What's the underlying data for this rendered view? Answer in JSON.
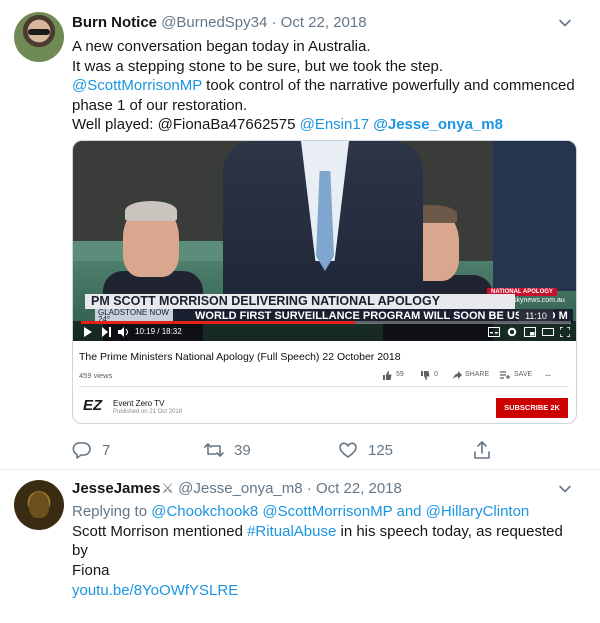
{
  "tweets": [
    {
      "display_name": "Burn Notice",
      "handle": "@BurnedSpy34",
      "date": "Oct 22, 2018",
      "lines": {
        "l1": "A new conversation began today in Australia.",
        "l2": "It was a stepping stone to be sure, but we took the step.",
        "l3_mention": "@ScottMorrisonMP",
        "l3_rest": " took control of the narrative powerfully and commenced",
        "l4": "phase 1 of our restoration.",
        "l5_text": "Well played: @FionaBa47662575 ",
        "l5_m1": "@Ensin17",
        "l5_m2": "@Jesse_onya_m8"
      },
      "embed": {
        "chyron_top": "PM SCOTT MORRISON DELIVERING NATIONAL APOLOGY",
        "chyron_bottom": "WORLD FIRST SURVEILLANCE PROGRAM WILL SOON BE USED TO M",
        "location": "GLADSTONE NOW 24°",
        "tag": "NATIONAL APOLOGY",
        "site": "skynews.com.au",
        "clock": "11:10",
        "timestamp": "10:19 / 18:32",
        "progress": 0.56,
        "video_title": "The Prime Ministers National Apology (Full Speech) 22 October 2018",
        "views": "459 views",
        "likes": "59",
        "dislikes": "0",
        "share": "SHARE",
        "save": "SAVE",
        "more": "...",
        "channel_logo": "EZ",
        "channel": "Event Zero TV",
        "published": "Published on 21 Oct 2018",
        "subscribe": "SUBSCRIBE  2K"
      },
      "stats": {
        "replies": "7",
        "retweets": "39",
        "likes": "125"
      }
    },
    {
      "display_name": "JesseJames",
      "handle": "@Jesse_onya_m8",
      "date": "Oct 22, 2018",
      "reply_prefix": "Replying to ",
      "reply_to": "@Chookchook8 @ScottMorrisonMP and @HillaryClinton",
      "text_pre": "Scott Morrison mentioned ",
      "hashtag": "#RitualAbuse",
      "text_post": " in his speech today, as requested by",
      "text_line2": "Fiona",
      "link": "youtu.be/8YoOWfYSLRE"
    }
  ],
  "icons": {
    "caret": "chevron-down-icon",
    "reply": "reply-icon",
    "retweet": "retweet-icon",
    "like": "heart-icon",
    "share": "share-icon",
    "emoji": "crossed-swords"
  },
  "colors": {
    "link": "#1b95e0",
    "muted": "#657786",
    "subscribe": "#cc0000",
    "progress": "#e62117"
  }
}
